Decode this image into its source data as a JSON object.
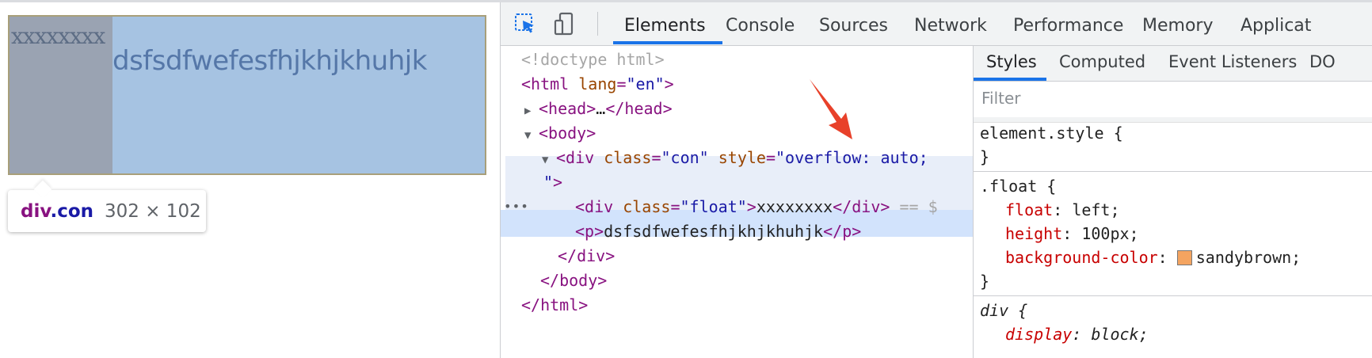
{
  "viewport": {
    "float_text": "xxxxxxxx",
    "p_text": "dsfsdfwefesfhjkhjkhuhjk",
    "tooltip": {
      "tag": "div",
      "class": ".con",
      "size": "302 × 102"
    }
  },
  "devtools": {
    "tabs": [
      "Elements",
      "Console",
      "Sources",
      "Network",
      "Performance",
      "Memory",
      "Applicat"
    ],
    "active_tab": "Elements",
    "dom": {
      "doctype": "<!doctype html>",
      "html_open_tag": "html",
      "html_attr_name": "lang",
      "html_attr_value": "\"en\"",
      "head": "head",
      "head_ellipsis": "…",
      "body": "body",
      "div_tag": "div",
      "div_class_name": "class",
      "div_class_value": "\"con\"",
      "div_style_name": "style",
      "div_style_value": "\"overflow: auto;",
      "div_style_cont": "\"",
      "float_class_value": "\"float\"",
      "float_text": "xxxxxxxx",
      "selected_marker": "== $",
      "p_tag": "p",
      "p_text": "dsfsdfwefesfhjkhjkhuhjk",
      "dots": "•••"
    },
    "styles_tabs": [
      "Styles",
      "Computed",
      "Event Listeners",
      "DO"
    ],
    "filter_placeholder": "Filter",
    "rules": {
      "element_style": "element.style",
      "float_selector": ".float",
      "float_props": [
        {
          "name": "float",
          "value": "left;"
        },
        {
          "name": "height",
          "value": "100px;"
        },
        {
          "name": "background-color",
          "value": "sandybrown;"
        }
      ],
      "div_selector": "div",
      "div_props": [
        {
          "name": "display",
          "value": "block;"
        }
      ]
    },
    "colors": {
      "accent": "#1a73e8",
      "swatch": "#f4a460",
      "arrow": "#e8412a"
    }
  }
}
